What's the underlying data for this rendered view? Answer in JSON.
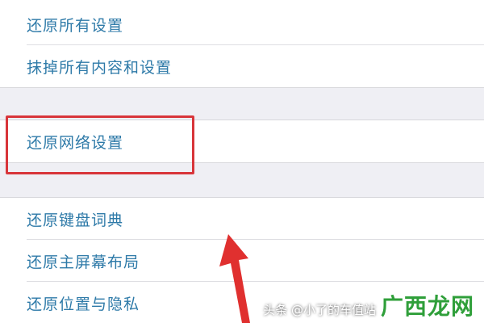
{
  "settings": {
    "group_top": [
      {
        "label": "还原所有设置"
      },
      {
        "label": "抹掉所有内容和设置"
      }
    ],
    "group_mid": [
      {
        "label": "还原网络设置"
      }
    ],
    "group_bottom": [
      {
        "label": "还原键盘词典"
      },
      {
        "label": "还原主屏幕布局"
      },
      {
        "label": "还原位置与隐私"
      }
    ]
  },
  "colors": {
    "label": "#2e7aa8",
    "highlight": "#d8353a",
    "arrow": "#e0302f",
    "background": "#efeff4"
  },
  "watermark": {
    "handle": "头条 @小了的车值站",
    "logo": "广西龙网"
  }
}
